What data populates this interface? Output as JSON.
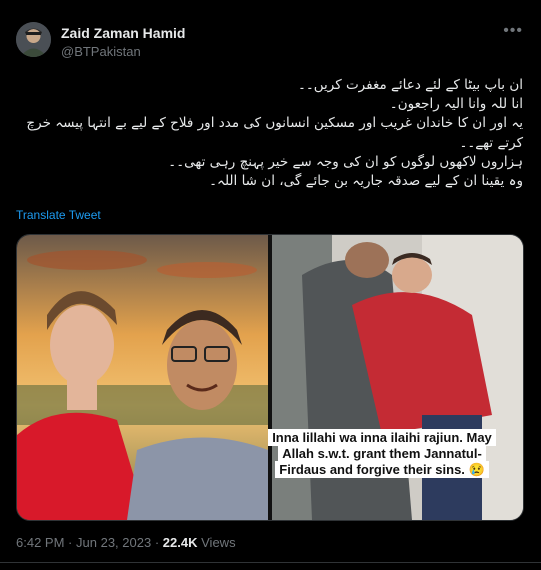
{
  "author": {
    "name": "Zaid Zaman Hamid",
    "handle": "@BTPakistan"
  },
  "tweet": {
    "lines": [
      "ان باپ بیٹا کے لئے دعائے مغفرت کریں۔۔",
      "انا للہ وانا الیہ راجعون۔",
      "یہ اور ان کا خاندان غریب اور مسکین انسانوں کی مدد اور فلاح کے لیے بے انتہا پیسہ خرچ کرتے تھے۔۔",
      "ہزاروں لاکھوں لوگوں کو ان کی وجہ سے خیر پہنچ رہی تھی۔۔",
      "وہ یقینا ان کے لیے صدقہ جاریہ بن جائے گی، ان شا اللہ۔"
    ],
    "translate_label": "Translate Tweet",
    "image_caption": "Inna lillahi wa inna ilaihi rajiun. May Allah s.w.t. grant them Jannatul-Firdaus and forgive their sins. 😢"
  },
  "meta": {
    "time": "6:42 PM",
    "separator": "·",
    "date": "Jun 23, 2023",
    "views_count": "22.4K",
    "views_label": "Views"
  },
  "icons": {
    "more": "more-dots-icon"
  },
  "colors": {
    "background": "#000000",
    "text": "#e7e9ea",
    "secondary": "#71767b",
    "link": "#1d9bf0",
    "border": "#2f3336"
  }
}
